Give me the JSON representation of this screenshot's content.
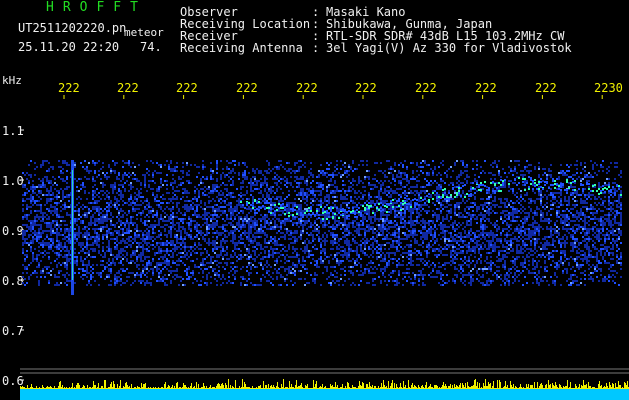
{
  "header": {
    "logo": "HROFFT",
    "filename": "UT2511202220.pn",
    "mode": "meteor",
    "date": "25.11.20 22:20",
    "count": "74.",
    "info_rows": [
      {
        "label": "Observer",
        "sep": ":",
        "value": "Masaki Kano"
      },
      {
        "label": "Receiving Location",
        "sep": ":",
        "value": "Shibukawa, Gunma, Japan"
      },
      {
        "label": "Receiver",
        "sep": ":",
        "value": "RTL-SDR SDR# 43dB L15 103.2MHz CW"
      },
      {
        "label": "Receiving Antenna",
        "sep": ":",
        "value": "3el Yagi(V) Az 330 for Vladivostok"
      }
    ]
  },
  "axis": {
    "unit": "kHz",
    "y_ticks": [
      "1.1",
      "1.0",
      "0.9",
      "0.8",
      "0.7",
      "0.6"
    ],
    "time_ticks": [
      "222",
      "222",
      "222",
      "222",
      "222",
      "222",
      "222",
      "222",
      "222",
      "2230"
    ]
  },
  "colors": {
    "background": "#000000",
    "axis_text": "#f0f0f0",
    "time_labels": "#f0f000",
    "logo": "#22dd22",
    "signal_low": "#1028a0",
    "signal_mid": "#2050ff",
    "signal_high": "#30ffb0",
    "level_bar": "#00c8ff",
    "level_peak": "#f0f000"
  }
}
